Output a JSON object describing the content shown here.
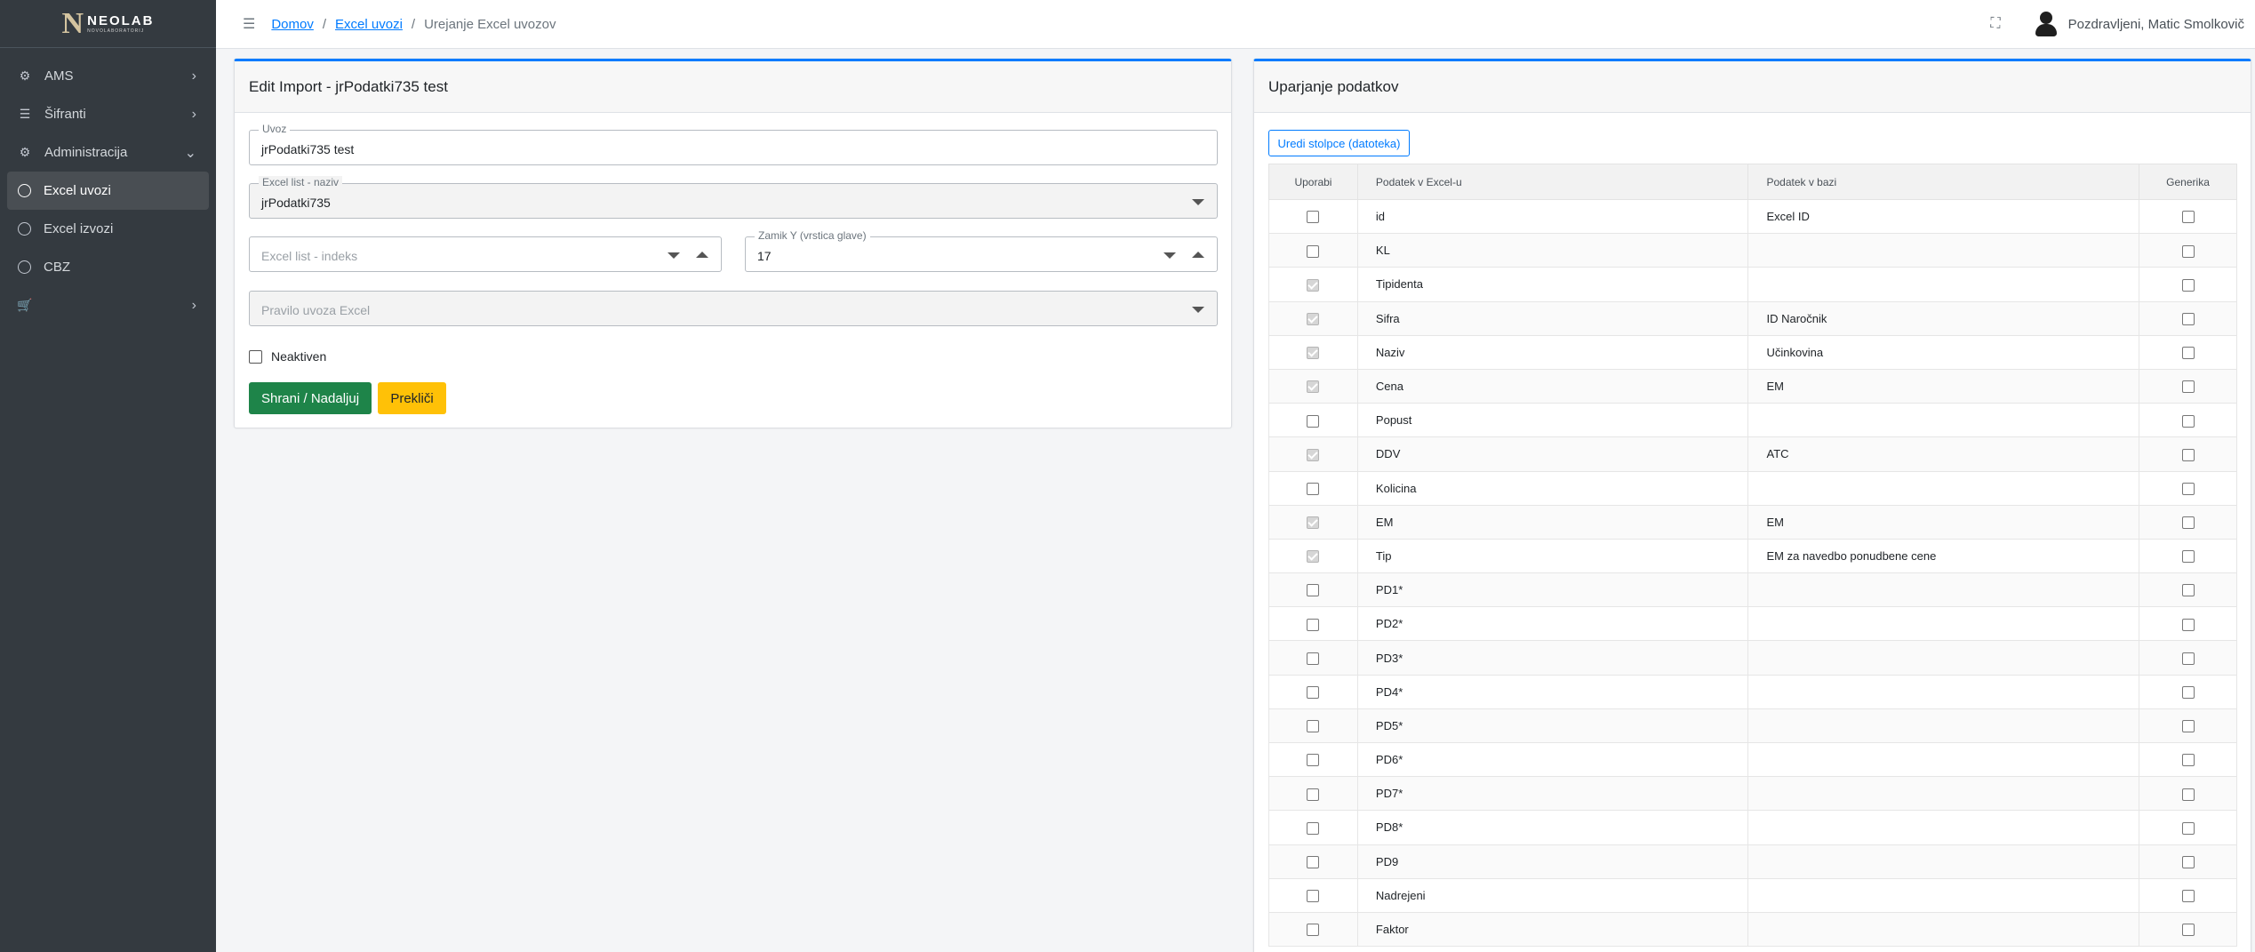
{
  "sidebar": {
    "logo": {
      "main": "NEOLAB",
      "sub": "NOVOLABORATORIJ"
    },
    "items": [
      {
        "label": "AMS",
        "icon": "gear-icon",
        "expandable": true
      },
      {
        "label": "Šifranti",
        "icon": "list-icon",
        "expandable": true
      },
      {
        "label": "Administracija",
        "icon": "gear-icon",
        "expandable": true,
        "expanded": true
      },
      {
        "label": "Excel uvozi",
        "icon": "circle-icon",
        "active": true
      },
      {
        "label": "Excel izvozi",
        "icon": "circle-icon"
      },
      {
        "label": "CBZ",
        "icon": "circle-icon"
      },
      {
        "label": "",
        "icon": "cart-icon",
        "expandable": true
      }
    ]
  },
  "header": {
    "breadcrumb": [
      "Domov",
      "Excel uvozi",
      "Urejanje Excel uvozov"
    ],
    "greeting": "Pozdravljeni, Matic Smolkovič"
  },
  "form": {
    "title": "Edit Import - jrPodatki735 test",
    "uvoz": {
      "label": "Uvoz",
      "value": "jrPodatki735 test"
    },
    "list_naziv": {
      "label": "Excel list - naziv",
      "value": "jrPodatki735"
    },
    "list_indeks": {
      "placeholder": "Excel list - indeks"
    },
    "zamik": {
      "label": "Zamik Y (vrstica glave)",
      "value": "17"
    },
    "pravilo": {
      "placeholder": "Pravilo uvoza Excel"
    },
    "neaktiven": "Neaktiven",
    "save_label": "Shrani / Nadaljuj",
    "cancel_label": "Prekliči"
  },
  "mapping": {
    "title": "Uparjanje podatkov",
    "edit_columns_label": "Uredi stolpce (datoteka)",
    "columns": [
      "Uporabi",
      "Podatek v Excel-u",
      "Podatek v bazi",
      "Generika"
    ],
    "rows": [
      {
        "use": false,
        "excel": "id",
        "db": "Excel ID",
        "generic": false
      },
      {
        "use": false,
        "excel": "KL",
        "db": "",
        "generic": false
      },
      {
        "use": true,
        "excel": "Tipidenta",
        "db": "",
        "generic": false
      },
      {
        "use": true,
        "excel": "Sifra",
        "db": "ID Naročnik",
        "generic": false
      },
      {
        "use": true,
        "excel": "Naziv",
        "db": "Učinkovina",
        "generic": false
      },
      {
        "use": true,
        "excel": "Cena",
        "db": "EM",
        "generic": false
      },
      {
        "use": false,
        "excel": "Popust",
        "db": "",
        "generic": false
      },
      {
        "use": true,
        "excel": "DDV",
        "db": "ATC",
        "generic": false
      },
      {
        "use": false,
        "excel": "Kolicina",
        "db": "",
        "generic": false
      },
      {
        "use": true,
        "excel": "EM",
        "db": "EM",
        "generic": false
      },
      {
        "use": true,
        "excel": "Tip",
        "db": "EM za navedbo ponudbene cene",
        "generic": false
      },
      {
        "use": false,
        "excel": "PD1*",
        "db": "",
        "generic": false
      },
      {
        "use": false,
        "excel": "PD2*",
        "db": "",
        "generic": false
      },
      {
        "use": false,
        "excel": "PD3*",
        "db": "",
        "generic": false
      },
      {
        "use": false,
        "excel": "PD4*",
        "db": "",
        "generic": false
      },
      {
        "use": false,
        "excel": "PD5*",
        "db": "",
        "generic": false
      },
      {
        "use": false,
        "excel": "PD6*",
        "db": "",
        "generic": false
      },
      {
        "use": false,
        "excel": "PD7*",
        "db": "",
        "generic": false
      },
      {
        "use": false,
        "excel": "PD8*",
        "db": "",
        "generic": false
      },
      {
        "use": false,
        "excel": "PD9",
        "db": "",
        "generic": false
      },
      {
        "use": false,
        "excel": "Nadrejeni",
        "db": "",
        "generic": false
      },
      {
        "use": false,
        "excel": "Faktor",
        "db": "",
        "generic": false
      }
    ]
  },
  "colors": {
    "sidebar_bg": "#343a40",
    "primary": "#007bff",
    "success": "#1e8449",
    "warning": "#ffc107"
  }
}
